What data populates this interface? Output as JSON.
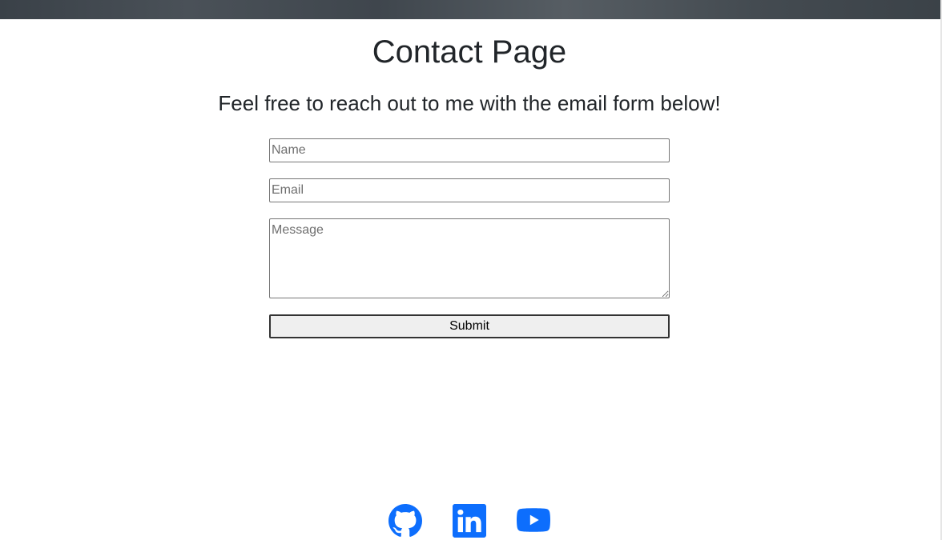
{
  "page": {
    "title": "Contact Page",
    "subtitle": "Feel free to reach out to me with the email form below!"
  },
  "form": {
    "name_placeholder": "Name",
    "email_placeholder": "Email",
    "message_placeholder": "Message",
    "submit_label": "Submit"
  },
  "social": {
    "icons": [
      "github-icon",
      "linkedin-icon",
      "youtube-icon"
    ],
    "accent_color": "#0d6efd"
  }
}
